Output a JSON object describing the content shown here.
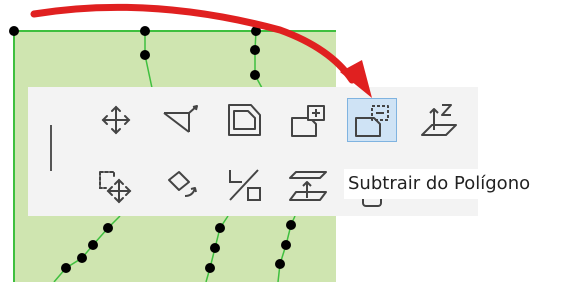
{
  "tooltip": {
    "text": "Subtrair do Polígono"
  },
  "colors": {
    "polygon_fill": "#cfe5b0",
    "polygon_edge": "#3fbf3f",
    "vertex": "#000000",
    "toolbar_bg": "#f3f3f3",
    "active_tool_bg": "#cfe3f5",
    "active_tool_border": "#7fb3e0",
    "annotation_arrow": "#e02020",
    "icon_stroke": "#444444"
  },
  "tools": [
    {
      "id": "move",
      "icon": "move-arrows-icon",
      "active": false
    },
    {
      "id": "tilt",
      "icon": "tilt-plane-icon",
      "active": false
    },
    {
      "id": "offset",
      "icon": "offset-edges-icon",
      "active": false
    },
    {
      "id": "add-to-polygon",
      "icon": "add-to-polygon-icon",
      "active": false
    },
    {
      "id": "subtract-from-polygon",
      "icon": "subtract-from-polygon-icon",
      "active": true
    },
    {
      "id": "elevate",
      "icon": "elevate-z-icon",
      "active": false
    },
    {
      "id": "drag-copy",
      "icon": "drag-copy-icon",
      "active": false
    },
    {
      "id": "rotate",
      "icon": "rotate-icon",
      "active": false
    },
    {
      "id": "resize",
      "icon": "resize-icon",
      "active": false
    },
    {
      "id": "offset-elevation",
      "icon": "offset-elevation-icon",
      "active": false
    }
  ]
}
